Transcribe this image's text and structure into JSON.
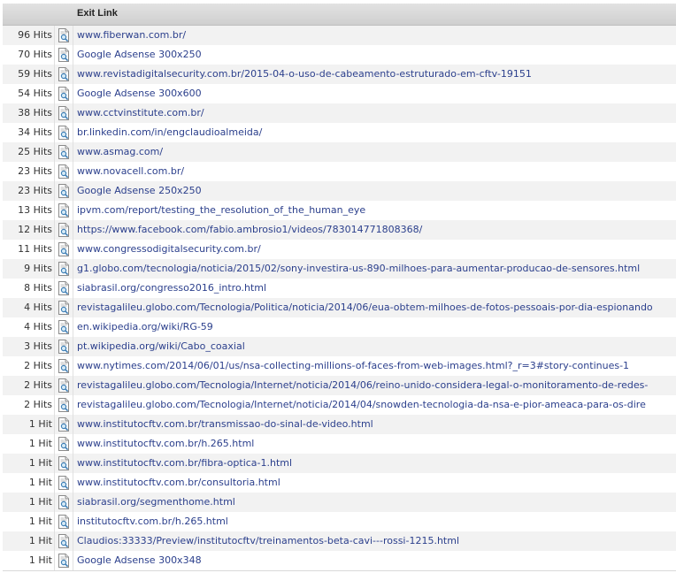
{
  "header": {
    "title": "Exit Link"
  },
  "rows": [
    {
      "hits": "96 Hits",
      "link": "www.fiberwan.com.br/"
    },
    {
      "hits": "70 Hits",
      "link": "Google Adsense 300x250"
    },
    {
      "hits": "59 Hits",
      "link": "www.revistadigitalsecurity.com.br/2015-04-o-uso-de-cabeamento-estruturado-em-cftv-19151"
    },
    {
      "hits": "54 Hits",
      "link": "Google Adsense 300x600"
    },
    {
      "hits": "38 Hits",
      "link": "www.cctvinstitute.com.br/"
    },
    {
      "hits": "34 Hits",
      "link": "br.linkedin.com/in/engclaudioalmeida/"
    },
    {
      "hits": "25 Hits",
      "link": "www.asmag.com/"
    },
    {
      "hits": "23 Hits",
      "link": "www.novacell.com.br/"
    },
    {
      "hits": "23 Hits",
      "link": "Google Adsense 250x250"
    },
    {
      "hits": "13 Hits",
      "link": "ipvm.com/report/testing_the_resolution_of_the_human_eye"
    },
    {
      "hits": "12 Hits",
      "link": "https://www.facebook.com/fabio.ambrosio1/videos/783014771808368/"
    },
    {
      "hits": "11 Hits",
      "link": "www.congressodigitalsecurity.com.br/"
    },
    {
      "hits": "9 Hits",
      "link": "g1.globo.com/tecnologia/noticia/2015/02/sony-investira-us-890-milhoes-para-aumentar-producao-de-sensores.html"
    },
    {
      "hits": "8 Hits",
      "link": "siabrasil.org/congresso2016_intro.html"
    },
    {
      "hits": "4 Hits",
      "link": "revistagalileu.globo.com/Tecnologia/Politica/noticia/2014/06/eua-obtem-milhoes-de-fotos-pessoais-por-dia-espionando"
    },
    {
      "hits": "4 Hits",
      "link": "en.wikipedia.org/wiki/RG-59"
    },
    {
      "hits": "3 Hits",
      "link": "pt.wikipedia.org/wiki/Cabo_coaxial"
    },
    {
      "hits": "2 Hits",
      "link": "www.nytimes.com/2014/06/01/us/nsa-collecting-millions-of-faces-from-web-images.html?_r=3#story-continues-1"
    },
    {
      "hits": "2 Hits",
      "link": "revistagalileu.globo.com/Tecnologia/Internet/noticia/2014/06/reino-unido-considera-legal-o-monitoramento-de-redes-"
    },
    {
      "hits": "2 Hits",
      "link": "revistagalileu.globo.com/Tecnologia/Internet/noticia/2014/04/snowden-tecnologia-da-nsa-e-pior-ameaca-para-os-dire"
    },
    {
      "hits": "1 Hit",
      "link": "www.institutocftv.com.br/transmissao-do-sinal-de-video.html"
    },
    {
      "hits": "1 Hit",
      "link": "www.institutocftv.com.br/h.265.html"
    },
    {
      "hits": "1 Hit",
      "link": "www.institutocftv.com.br/fibra-optica-1.html"
    },
    {
      "hits": "1 Hit",
      "link": "www.institutocftv.com.br/consultoria.html"
    },
    {
      "hits": "1 Hit",
      "link": "siabrasil.org/segmenthome.html"
    },
    {
      "hits": "1 Hit",
      "link": "institutocftv.com.br/h.265.html"
    },
    {
      "hits": "1 Hit",
      "link": "Claudios:33333/Preview/institutocftv/treinamentos-beta-cavi---rossi-1215.html"
    },
    {
      "hits": "1 Hit",
      "link": "Google Adsense 300x348"
    }
  ]
}
